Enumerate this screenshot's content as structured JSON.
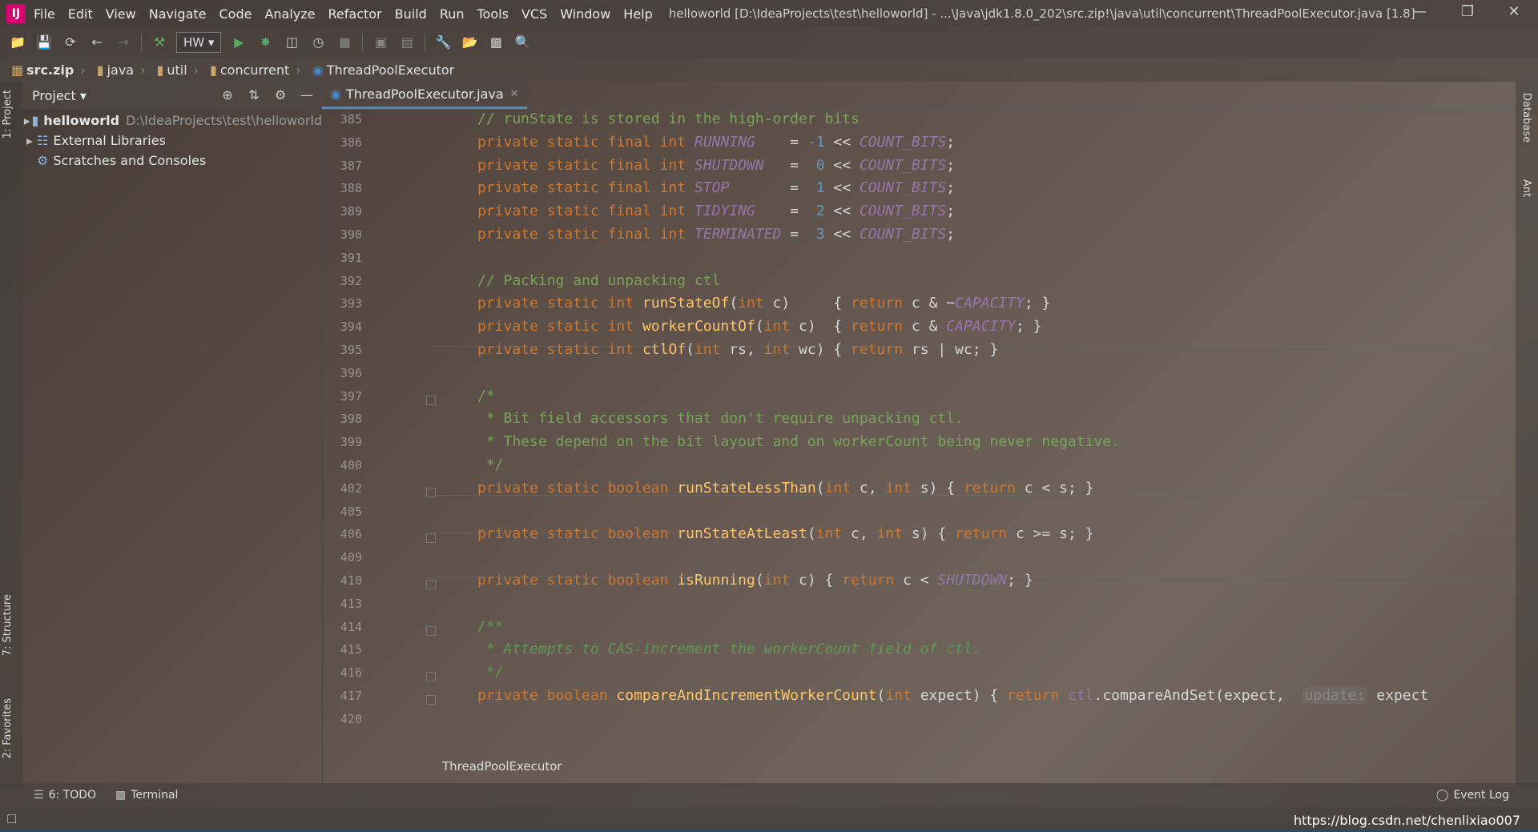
{
  "menubar": {
    "items": [
      "File",
      "Edit",
      "View",
      "Navigate",
      "Code",
      "Analyze",
      "Refactor",
      "Build",
      "Run",
      "Tools",
      "VCS",
      "Window",
      "Help"
    ],
    "title": "helloworld [D:\\IdeaProjects\\test\\helloworld] - ...\\Java\\jdk1.8.0_202\\src.zip!\\java\\util\\concurrent\\ThreadPoolExecutor.java [1.8]"
  },
  "toolbar": {
    "run_config": "HW"
  },
  "breadcrumbs": [
    "src.zip",
    "java",
    "util",
    "concurrent",
    "ThreadPoolExecutor"
  ],
  "left_stripe": {
    "project": "1: Project",
    "structure": "7: Structure",
    "favorites": "2: Favorites"
  },
  "project_panel": {
    "title": "Project",
    "items": [
      {
        "label": "helloworld",
        "path": "D:\\IdeaProjects\\test\\helloworld"
      },
      {
        "label": "External Libraries"
      },
      {
        "label": "Scratches and Consoles"
      }
    ]
  },
  "editor": {
    "tab": "ThreadPoolExecutor.java",
    "line_numbers": [
      "385",
      "386",
      "387",
      "388",
      "389",
      "390",
      "391",
      "392",
      "393",
      "394",
      "395",
      "396",
      "397",
      "398",
      "399",
      "400",
      "402",
      "405",
      "406",
      "409",
      "410",
      "413",
      "414",
      "415",
      "416",
      "417",
      "420"
    ],
    "code_lines": [
      "// runState is stored in the high-order bits",
      "private static final int RUNNING    = -1 << COUNT_BITS;",
      "private static final int SHUTDOWN   =  0 << COUNT_BITS;",
      "private static final int STOP       =  1 << COUNT_BITS;",
      "private static final int TIDYING    =  2 << COUNT_BITS;",
      "private static final int TERMINATED =  3 << COUNT_BITS;",
      "",
      "// Packing and unpacking ctl",
      "private static int runStateOf(int c)     { return c & ~CAPACITY; }",
      "private static int workerCountOf(int c)  { return c & CAPACITY; }",
      "private static int ctlOf(int rs, int wc) { return rs | wc; }",
      "",
      "/*",
      " * Bit field accessors that don't require unpacking ctl.",
      " * These depend on the bit layout and on workerCount being never negative.",
      " */",
      "private static boolean runStateLessThan(int c, int s) { return c < s; }",
      "",
      "private static boolean runStateAtLeast(int c, int s) { return c >= s; }",
      "",
      "private static boolean isRunning(int c) { return c < SHUTDOWN; }",
      "",
      "/**",
      " * Attempts to CAS-increment the workerCount field of ctl.",
      " */",
      "private boolean compareAndIncrementWorkerCount(int expect) { return ctl.compareAndSet(expect,  update: expect",
      ""
    ],
    "hint_label": "update:",
    "bottom_crumb": "ThreadPoolExecutor"
  },
  "right_stripe": {
    "database": "Database",
    "ant": "Ant"
  },
  "bottom_tools": {
    "todo": "6: TODO",
    "terminal": "Terminal",
    "event_log": "Event Log"
  },
  "status": {
    "watermark": "https://blog.csdn.net/chenlixiao007"
  },
  "colors": {
    "accent": "#4a88c7",
    "keyword": "#cc7832",
    "comment": "#629755",
    "constant": "#9876aa",
    "method": "#ffc66d"
  }
}
